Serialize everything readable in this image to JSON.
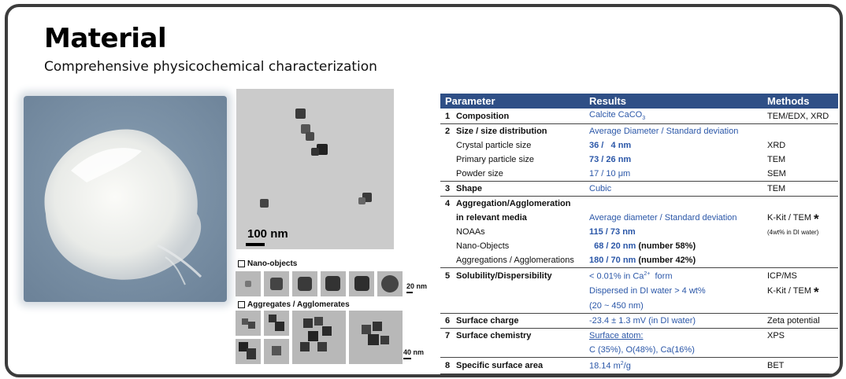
{
  "slide": {
    "title": "Material",
    "subtitle": "Comprehensive physicochemical characterization"
  },
  "micrographs": {
    "tem_scale": "100 nm",
    "nano_objects_label": "Nano-objects",
    "nano_scale": "20 nm",
    "aggregates_label": "Aggregates / Agglomerates",
    "aggregates_scale": "40 nm"
  },
  "table": {
    "headers": {
      "parameter": "Parameter",
      "results": "Results",
      "methods": "Methods"
    },
    "rows": [
      {
        "num": "1",
        "param": "Composition",
        "result": "Calcite CaCO",
        "result_sub": "3",
        "method": "TEM/EDX, XRD"
      },
      {
        "num": "2",
        "param": "Size / size distribution",
        "result": "Average Diameter / Standard deviation",
        "method": ""
      },
      {
        "param": "Crystal particle size",
        "result": "36 /   4 nm",
        "method": "XRD"
      },
      {
        "param": "Primary particle size",
        "result": "73 / 26 nm",
        "method": "TEM"
      },
      {
        "param": "Powder size",
        "result": "17 / 10 μm",
        "method": "SEM"
      },
      {
        "num": "3",
        "param": "Shape",
        "result": "Cubic",
        "method": "TEM"
      },
      {
        "num": "4",
        "param": "Aggregation/Agglomeration",
        "result": "",
        "method": ""
      },
      {
        "param": "in relevant media",
        "result": "Average diameter / Standard deviation",
        "method": "K-Kit / TEM",
        "star": "*"
      },
      {
        "param": "NOAAs",
        "result": "115 / 73 nm",
        "method": "(4wt% in DI water)"
      },
      {
        "param": "Nano-Objects",
        "result": "  68 / 20 nm",
        "result_extra": "(number 58%)",
        "method": ""
      },
      {
        "param": "Aggregations / Agglomerations",
        "result": "180 / 70 nm",
        "result_extra": "(number 42%)",
        "method": ""
      },
      {
        "num": "5",
        "param": "Solubility/Dispersibility",
        "result": "< 0.01% in Ca",
        "result_sup": "2+",
        "result_tail": "  form",
        "method": "ICP/MS"
      },
      {
        "param": "",
        "result": "Dispersed in DI water > 4 wt%",
        "method": "K-Kit / TEM",
        "star": "*"
      },
      {
        "param": "",
        "result": "(20 ~ 450 nm)",
        "method": ""
      },
      {
        "num": "6",
        "param": "Surface charge",
        "result": "-23.4 ± 1.3 mV (in DI water)",
        "method": "Zeta potential"
      },
      {
        "num": "7",
        "param": "Surface chemistry",
        "result": "Surface atom:",
        "method": "XPS"
      },
      {
        "param": "",
        "result": "C (35%), O(48%), Ca(16%)",
        "method": ""
      },
      {
        "num": "8",
        "param": "Specific surface area",
        "result": "18.14 m",
        "result_sup": "2",
        "result_tail": "/g",
        "method": "BET"
      }
    ]
  }
}
